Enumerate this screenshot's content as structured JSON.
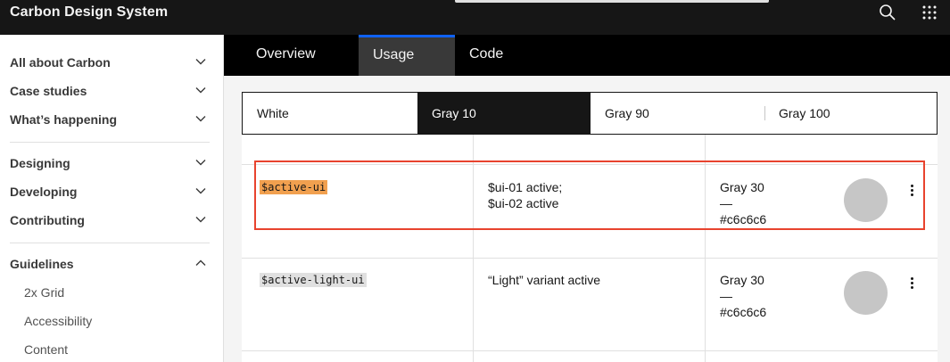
{
  "header": {
    "brand": "Carbon Design System",
    "search_icon": "search-icon",
    "switcher_icon": "app-switcher-icon"
  },
  "sidebar": {
    "groups_top": [
      {
        "label": "All about Carbon"
      },
      {
        "label": "Case studies"
      },
      {
        "label": "What’s happening"
      }
    ],
    "groups_mid": [
      {
        "label": "Designing"
      },
      {
        "label": "Developing"
      },
      {
        "label": "Contributing"
      }
    ],
    "guidelines": {
      "label": "Guidelines",
      "expanded": true,
      "children": [
        {
          "label": "2x Grid"
        },
        {
          "label": "Accessibility"
        },
        {
          "label": "Content"
        }
      ]
    }
  },
  "tabs": [
    {
      "label": "Overview",
      "active": false
    },
    {
      "label": "Usage",
      "active": true
    },
    {
      "label": "Code",
      "active": false
    }
  ],
  "theme_switcher": {
    "options": [
      "White",
      "Gray 10",
      "Gray 90",
      "Gray 100"
    ],
    "selected": "Gray 10"
  },
  "table": {
    "rows": [
      {
        "token": "$active-ui",
        "token_highlighted": true,
        "role_lines": [
          "$ui-01 active;",
          "$ui-02 active"
        ],
        "value_name": "Gray 30",
        "value_dash": "—",
        "value_hex": "#c6c6c6",
        "swatch_color": "#c6c6c6"
      },
      {
        "token": "$active-light-ui",
        "token_highlighted": false,
        "role_lines": [
          "“Light” variant active"
        ],
        "value_name": "Gray 30",
        "value_dash": "—",
        "value_hex": "#c6c6c6",
        "swatch_color": "#c6c6c6"
      }
    ]
  },
  "colors": {
    "header_bg": "#161616",
    "tab_active_accent": "#0f62fe",
    "highlight_outline": "#e8432e",
    "token_highlight": "#f1a04f"
  }
}
